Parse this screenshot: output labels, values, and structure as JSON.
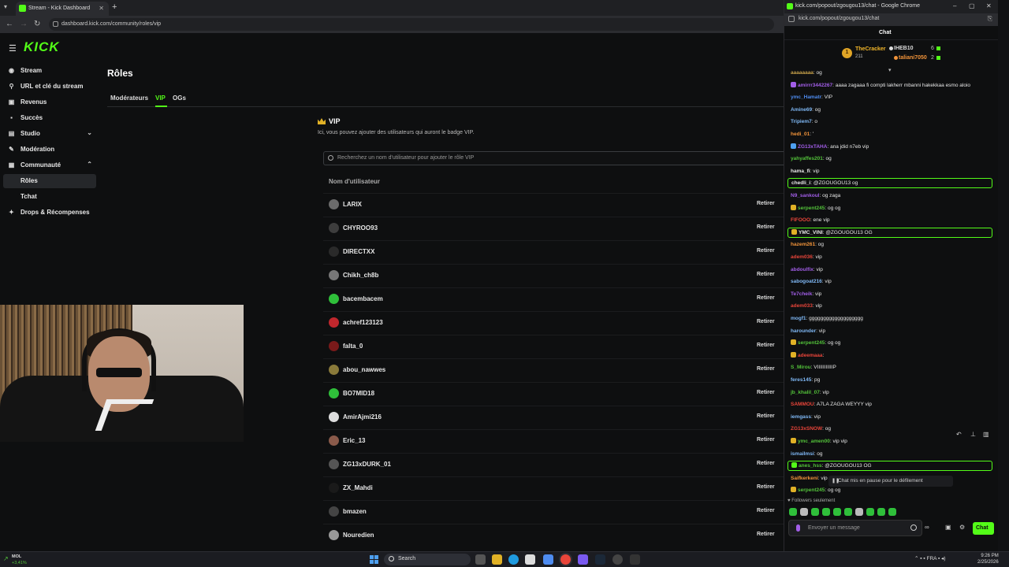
{
  "browser": {
    "tab_title": "Stream - Kick Dashboard",
    "url": "dashboard.kick.com/community/roles/vip"
  },
  "sidebar": {
    "logo": "KICK",
    "items": [
      {
        "label": "Stream",
        "icon": "broadcast-icon"
      },
      {
        "label": "URL et clé du stream",
        "icon": "link-icon"
      },
      {
        "label": "Revenus",
        "icon": "money-icon"
      },
      {
        "label": "Succès",
        "icon": "trophy-icon"
      },
      {
        "label": "Studio",
        "icon": "studio-icon"
      },
      {
        "label": "Modération",
        "icon": "wrench-icon"
      },
      {
        "label": "Communauté",
        "icon": "community-icon"
      },
      {
        "label": "Rôles",
        "icon": ""
      },
      {
        "label": "Tchat",
        "icon": ""
      },
      {
        "label": "Drops & Récompenses",
        "icon": "gift-icon"
      }
    ]
  },
  "main": {
    "title": "Rôles",
    "tabs": [
      "Modérateurs",
      "VIP",
      "OGs"
    ],
    "active_tab": "VIP",
    "section_title": "VIP",
    "section_desc": "Ici, vous pouvez ajouter des utilisateurs qui auront le badge VIP.",
    "search_placeholder": "Recherchez un nom d'utilisateur pour ajouter le rôle VIP",
    "column_header": "Nom d'utilisateur",
    "remove_label": "Retirer",
    "users": [
      {
        "name": "LARIX",
        "avatar_color": "#6b6b6b"
      },
      {
        "name": "CHYROO93",
        "avatar_color": "#3d3d3d"
      },
      {
        "name": "DIRECTXX",
        "avatar_color": "#2a2a2a"
      },
      {
        "name": "Chikh_ch8b",
        "avatar_color": "#777777"
      },
      {
        "name": "bacembacem",
        "avatar_color": "#2fbf3a"
      },
      {
        "name": "achref123123",
        "avatar_color": "#c0272d"
      },
      {
        "name": "falta_0",
        "avatar_color": "#7a1a1a"
      },
      {
        "name": "abou_nawwes",
        "avatar_color": "#8a7a3a"
      },
      {
        "name": "BO7MID18",
        "avatar_color": "#2fbf3a"
      },
      {
        "name": "AmirAjmi216",
        "avatar_color": "#dddddd"
      },
      {
        "name": "Eric_13",
        "avatar_color": "#8a5a4a"
      },
      {
        "name": "ZG13xDURK_01",
        "avatar_color": "#555555"
      },
      {
        "name": "ZX_Mahdi",
        "avatar_color": "#1a1a1a"
      },
      {
        "name": "bmazen",
        "avatar_color": "#444444"
      },
      {
        "name": "Nouredien",
        "avatar_color": "#999999"
      }
    ]
  },
  "chat": {
    "window_title": "kick.com/popout/zgougou13/chat - Google Chrome",
    "url": "kick.com/popout/zgougou13/chat",
    "header": "Chat",
    "leaderboard": {
      "first": {
        "name": "TheCracker",
        "count": "211"
      },
      "second": {
        "name": "IHEB10",
        "count": "6"
      },
      "third": {
        "name": "taliani7050",
        "count": "2"
      }
    },
    "messages": [
      {
        "user": "aaaaaaaa",
        "color": "#c8a24a",
        "text": "og",
        "badge": "",
        "highlight": false
      },
      {
        "user": "amirrr3442267",
        "color": "#a25ee8",
        "text": "aaaa zagaaa fi compti lakherr mbanni hakekkaa esmo aloio",
        "badge": "#a25ee8",
        "highlight": false
      },
      {
        "user": "ymc_Hamatr",
        "color": "#4e8cf0",
        "text": "VIP",
        "badge": "",
        "highlight": false
      },
      {
        "user": "Amine69",
        "color": "#7fb8f5",
        "text": "og",
        "badge": "",
        "highlight": false
      },
      {
        "user": "Tripiem7",
        "color": "#7fb8f5",
        "text": "o",
        "badge": "",
        "highlight": false
      },
      {
        "user": "hedi_01",
        "color": "#f2943a",
        "text": "'",
        "badge": "",
        "highlight": false
      },
      {
        "user": "ZG13xTAHA",
        "color": "#a25ee8",
        "text": "ana jdid n7eb vip",
        "badge": "#4ea0f0",
        "highlight": false
      },
      {
        "user": "yahyaffes201",
        "color": "#53c23a",
        "text": "og",
        "badge": "",
        "highlight": false
      },
      {
        "user": "hama_fi",
        "color": "#e8e8e8",
        "text": "vip",
        "badge": "",
        "highlight": false
      },
      {
        "user": "chedli_i",
        "color": "#e8e8e8",
        "text": "@ZGOUGOU13 og",
        "badge": "",
        "highlight": true
      },
      {
        "user": "N9_sankoul",
        "color": "#a25ee8",
        "text": "og zaga",
        "badge": "",
        "highlight": false
      },
      {
        "user": "serpent245",
        "color": "#53c23a",
        "text": "og og",
        "badge": "#e0b126",
        "highlight": false
      },
      {
        "user": "FIFOOO",
        "color": "#e8453a",
        "text": "ene vip",
        "badge": "",
        "highlight": false
      },
      {
        "user": "YMC_VINI",
        "color": "#e8e8e8",
        "text": "@ZGOUGOU13 OG",
        "badge": "#e0b126",
        "highlight": true
      },
      {
        "user": "hazem261",
        "color": "#f2943a",
        "text": "og",
        "badge": "",
        "highlight": false
      },
      {
        "user": "adem036",
        "color": "#e8453a",
        "text": "vip",
        "badge": "",
        "highlight": false
      },
      {
        "user": "abdoulfix",
        "color": "#a25ee8",
        "text": "vip",
        "badge": "",
        "highlight": false
      },
      {
        "user": "sabogoat216",
        "color": "#7fb8f5",
        "text": "vip",
        "badge": "",
        "highlight": false
      },
      {
        "user": "Te7cheik",
        "color": "#a25ee8",
        "text": "vip",
        "badge": "",
        "highlight": false
      },
      {
        "user": "adem033",
        "color": "#e8453a",
        "text": "vip",
        "badge": "",
        "highlight": false
      },
      {
        "user": "mogf1",
        "color": "#7fb8f5",
        "text": "ggggggggggggggggggg",
        "badge": "",
        "highlight": false
      },
      {
        "user": "harounder",
        "color": "#7fb8f5",
        "text": "vip",
        "badge": "",
        "highlight": false
      },
      {
        "user": "serpent245",
        "color": "#53c23a",
        "text": "og og",
        "badge": "#e0b126",
        "highlight": false
      },
      {
        "user": "adeemaaa",
        "color": "#e8453a",
        "text": "",
        "badge": "#e0b126",
        "highlight": false
      },
      {
        "user": "S_Mirou",
        "color": "#53c23a",
        "text": "VIIIIIIIIIIIP",
        "badge": "",
        "highlight": false
      },
      {
        "user": "feres145",
        "color": "#7fb8f5",
        "text": "pg",
        "badge": "",
        "highlight": false
      },
      {
        "user": "jb_khalil_07",
        "color": "#53c23a",
        "text": "vip",
        "badge": "",
        "highlight": false
      },
      {
        "user": "SAMMOU",
        "color": "#e8453a",
        "text": "A7LA ZAGA WEYYY vip",
        "badge": "",
        "highlight": false
      },
      {
        "user": "iemgass",
        "color": "#7fb8f5",
        "text": "vip",
        "badge": "",
        "highlight": false
      },
      {
        "user": "ZG13xSNOW",
        "color": "#e8453a",
        "text": "og",
        "badge": "",
        "highlight": false
      },
      {
        "user": "ymc_amen00",
        "color": "#53c23a",
        "text": "vip vip",
        "badge": "#e0b126",
        "highlight": false
      },
      {
        "user": "ismailmsi",
        "color": "#7fb8f5",
        "text": "og",
        "badge": "",
        "highlight": false
      },
      {
        "user": "anes_hss",
        "color": "#53c23a",
        "text": "@ZGOUGOU13 OG",
        "badge": "#53fc18",
        "highlight": true
      },
      {
        "user": "Saifkerkeni",
        "color": "#f2943a",
        "text": "vip",
        "badge": "",
        "highlight": false
      },
      {
        "user": "serpent245",
        "color": "#53c23a",
        "text": "og og",
        "badge": "#e0b126",
        "highlight": false
      }
    ],
    "pause_banner": "Chat mis en pause pour le défilement",
    "followers_label": "Followers seulement",
    "input_placeholder": "Envoyer un message",
    "send_label": "Chat"
  },
  "taskbar": {
    "stock_name": "MOL",
    "stock_change": "+3,41%",
    "search_label": "Search",
    "lang": "FRA",
    "time": "9:26 PM",
    "date": "2/25/2026"
  },
  "colors": {
    "accent": "#53fc18",
    "bg": "#0e0f10"
  }
}
